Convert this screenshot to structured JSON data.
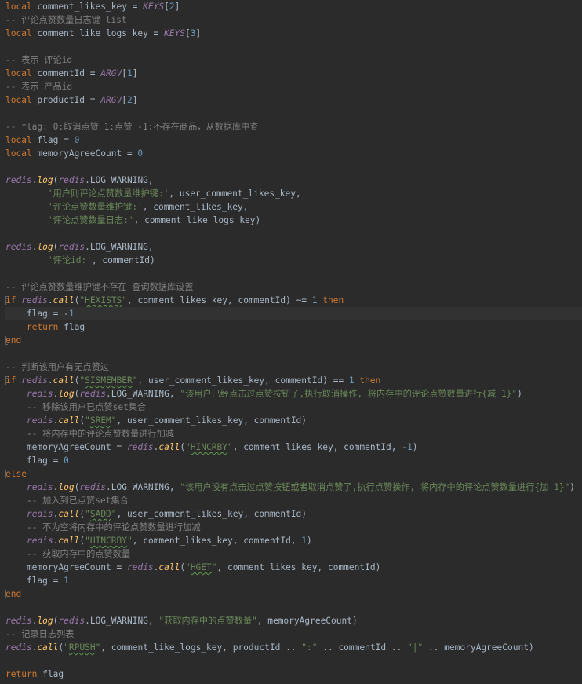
{
  "editor": {
    "language": "lua",
    "caret_line_index": 23,
    "colors": {
      "background": "#2b2b2b",
      "caret_line": "#323232",
      "keyword": "#cc7832",
      "identifier": "#a9b7c6",
      "global": "#9876aa",
      "function": "#ffc66d",
      "string": "#6a8759",
      "number": "#6897bb",
      "comment": "#808080"
    },
    "lines": [
      [
        [
          "kw",
          "local"
        ],
        [
          "ident",
          " comment_likes_key = "
        ],
        [
          "global",
          "KEYS"
        ],
        [
          "ident",
          "["
        ],
        [
          "num",
          "2"
        ],
        [
          "ident",
          "]"
        ]
      ],
      [
        [
          "cmt",
          "-- 评论点赞数量日志键 list"
        ]
      ],
      [
        [
          "kw",
          "local"
        ],
        [
          "ident",
          " comment_like_logs_key = "
        ],
        [
          "global",
          "KEYS"
        ],
        [
          "ident",
          "["
        ],
        [
          "num",
          "3"
        ],
        [
          "ident",
          "]"
        ]
      ],
      [],
      [
        [
          "cmt",
          "-- 表示 评论id"
        ]
      ],
      [
        [
          "kw",
          "local"
        ],
        [
          "ident",
          " commentId = "
        ],
        [
          "global",
          "ARGV"
        ],
        [
          "ident",
          "["
        ],
        [
          "num",
          "1"
        ],
        [
          "ident",
          "]"
        ]
      ],
      [
        [
          "cmt",
          "-- 表示 产品id"
        ]
      ],
      [
        [
          "kw",
          "local"
        ],
        [
          "ident",
          " productId = "
        ],
        [
          "global",
          "ARGV"
        ],
        [
          "ident",
          "["
        ],
        [
          "num",
          "2"
        ],
        [
          "ident",
          "]"
        ]
      ],
      [],
      [
        [
          "cmt",
          "-- flag: 0:取消点赞 1:点赞 -1:不存在商品，从数据库中查"
        ]
      ],
      [
        [
          "kw",
          "local"
        ],
        [
          "ident",
          " flag = "
        ],
        [
          "num",
          "0"
        ]
      ],
      [
        [
          "kw",
          "local"
        ],
        [
          "ident",
          " memoryAgreeCount = "
        ],
        [
          "num",
          "0"
        ]
      ],
      [],
      [
        [
          "global",
          "redis"
        ],
        [
          "ident",
          "."
        ],
        [
          "fn",
          "log"
        ],
        [
          "ident",
          "("
        ],
        [
          "global",
          "redis"
        ],
        [
          "ident",
          ".LOG_WARNING,"
        ]
      ],
      [
        [
          "ident",
          "        "
        ],
        [
          "str",
          "'用户则评论点赞数量维护键:'"
        ],
        [
          "ident",
          ", user_comment_likes_key,"
        ]
      ],
      [
        [
          "ident",
          "        "
        ],
        [
          "str",
          "'评论点赞数量维护键:'"
        ],
        [
          "ident",
          ", comment_likes_key,"
        ]
      ],
      [
        [
          "ident",
          "        "
        ],
        [
          "str",
          "'评论点赞数量日志:'"
        ],
        [
          "ident",
          ", comment_like_logs_key)"
        ]
      ],
      [],
      [
        [
          "global",
          "redis"
        ],
        [
          "ident",
          "."
        ],
        [
          "fn",
          "log"
        ],
        [
          "ident",
          "("
        ],
        [
          "global",
          "redis"
        ],
        [
          "ident",
          ".LOG_WARNING,"
        ]
      ],
      [
        [
          "ident",
          "        "
        ],
        [
          "str",
          "'评论id:'"
        ],
        [
          "ident",
          ", commentId)"
        ]
      ],
      [],
      [
        [
          "cmt",
          "-- 评论点赞数量维护键不存在 查询数据库设置"
        ]
      ],
      [
        [
          "kw",
          "if"
        ],
        [
          "ident",
          " "
        ],
        [
          "global",
          "redis"
        ],
        [
          "ident",
          "."
        ],
        [
          "fn",
          "call"
        ],
        [
          "ident",
          "("
        ],
        [
          "str",
          "\""
        ],
        [
          "str typo",
          "HEXISTS"
        ],
        [
          "str",
          "\""
        ],
        [
          "ident",
          ", comment_likes_key, commentId) ~= "
        ],
        [
          "num",
          "1"
        ],
        [
          "ident",
          " "
        ],
        [
          "kw",
          "then"
        ]
      ],
      [
        [
          "ident",
          "    flag = -"
        ],
        [
          "num",
          "1"
        ],
        [
          "caret",
          ""
        ]
      ],
      [
        [
          "ident",
          "    "
        ],
        [
          "kw",
          "return"
        ],
        [
          "ident",
          " flag"
        ]
      ],
      [
        [
          "kw",
          "end"
        ]
      ],
      [],
      [
        [
          "cmt",
          "-- 判断该用户有无点赞过"
        ]
      ],
      [
        [
          "kw",
          "if"
        ],
        [
          "ident",
          " "
        ],
        [
          "global",
          "redis"
        ],
        [
          "ident",
          "."
        ],
        [
          "fn",
          "call"
        ],
        [
          "ident",
          "("
        ],
        [
          "str",
          "\""
        ],
        [
          "str typo",
          "SISMEMBER"
        ],
        [
          "str",
          "\""
        ],
        [
          "ident",
          ", user_comment_likes_key, commentId) == "
        ],
        [
          "num",
          "1"
        ],
        [
          "ident",
          " "
        ],
        [
          "kw",
          "then"
        ]
      ],
      [
        [
          "ident",
          "    "
        ],
        [
          "global",
          "redis"
        ],
        [
          "ident",
          "."
        ],
        [
          "fn",
          "log"
        ],
        [
          "ident",
          "("
        ],
        [
          "global",
          "redis"
        ],
        [
          "ident",
          ".LOG_WARNING, "
        ],
        [
          "str",
          "\"该用户已经点击过点赞按钮了,执行取消操作, 将内存中的评论点赞数量进行{减 1}\""
        ],
        [
          "ident",
          ")"
        ]
      ],
      [
        [
          "cmt",
          "    -- 移除该用户已点赞set集合"
        ]
      ],
      [
        [
          "ident",
          "    "
        ],
        [
          "global",
          "redis"
        ],
        [
          "ident",
          "."
        ],
        [
          "fn",
          "call"
        ],
        [
          "ident",
          "("
        ],
        [
          "str",
          "\""
        ],
        [
          "str typo",
          "SREM"
        ],
        [
          "str",
          "\""
        ],
        [
          "ident",
          ", user_comment_likes_key, commentId)"
        ]
      ],
      [
        [
          "cmt",
          "    -- 将内存中的评论点赞数量进行加减"
        ]
      ],
      [
        [
          "ident",
          "    memoryAgreeCount = "
        ],
        [
          "global",
          "redis"
        ],
        [
          "ident",
          "."
        ],
        [
          "fn",
          "call"
        ],
        [
          "ident",
          "("
        ],
        [
          "str",
          "\""
        ],
        [
          "str typo",
          "HINCRBY"
        ],
        [
          "str",
          "\""
        ],
        [
          "ident",
          ", comment_likes_key, commentId, -"
        ],
        [
          "num",
          "1"
        ],
        [
          "ident",
          ")"
        ]
      ],
      [
        [
          "ident",
          "    flag = "
        ],
        [
          "num",
          "0"
        ]
      ],
      [
        [
          "kw",
          "else"
        ]
      ],
      [
        [
          "ident",
          "    "
        ],
        [
          "global",
          "redis"
        ],
        [
          "ident",
          "."
        ],
        [
          "fn",
          "log"
        ],
        [
          "ident",
          "("
        ],
        [
          "global",
          "redis"
        ],
        [
          "ident",
          ".LOG_WARNING, "
        ],
        [
          "str",
          "\"该用户没有点击过点赞按钮或者取消点赞了,执行点赞操作, 将内存中的评论点赞数量进行{加 1}\""
        ],
        [
          "ident",
          ")"
        ]
      ],
      [
        [
          "cmt",
          "    -- 加入到已点赞set集合"
        ]
      ],
      [
        [
          "ident",
          "    "
        ],
        [
          "global",
          "redis"
        ],
        [
          "ident",
          "."
        ],
        [
          "fn",
          "call"
        ],
        [
          "ident",
          "("
        ],
        [
          "str",
          "\""
        ],
        [
          "str typo",
          "SADD"
        ],
        [
          "str",
          "\""
        ],
        [
          "ident",
          ", user_comment_likes_key, commentId)"
        ]
      ],
      [
        [
          "cmt",
          "    -- 不为空将内存中的评论点赞数量进行加减"
        ]
      ],
      [
        [
          "ident",
          "    "
        ],
        [
          "global",
          "redis"
        ],
        [
          "ident",
          "."
        ],
        [
          "fn",
          "call"
        ],
        [
          "ident",
          "("
        ],
        [
          "str",
          "\""
        ],
        [
          "str typo",
          "HINCRBY"
        ],
        [
          "str",
          "\""
        ],
        [
          "ident",
          ", comment_likes_key, commentId, "
        ],
        [
          "num",
          "1"
        ],
        [
          "ident",
          ")"
        ]
      ],
      [
        [
          "cmt",
          "    -- 获取内存中的点赞数量"
        ]
      ],
      [
        [
          "ident",
          "    memoryAgreeCount = "
        ],
        [
          "global",
          "redis"
        ],
        [
          "ident",
          "."
        ],
        [
          "fn",
          "call"
        ],
        [
          "ident",
          "("
        ],
        [
          "str",
          "\""
        ],
        [
          "str typo",
          "HGET"
        ],
        [
          "str",
          "\""
        ],
        [
          "ident",
          ", comment_likes_key, commentId)"
        ]
      ],
      [
        [
          "ident",
          "    flag = "
        ],
        [
          "num",
          "1"
        ]
      ],
      [
        [
          "kw",
          "end"
        ]
      ],
      [],
      [
        [
          "global",
          "redis"
        ],
        [
          "ident",
          "."
        ],
        [
          "fn",
          "log"
        ],
        [
          "ident",
          "("
        ],
        [
          "global",
          "redis"
        ],
        [
          "ident",
          ".LOG_WARNING, "
        ],
        [
          "str",
          "\"获取内存中的点赞数量\""
        ],
        [
          "ident",
          ", memoryAgreeCount)"
        ]
      ],
      [
        [
          "cmt",
          "-- 记录日志列表"
        ]
      ],
      [
        [
          "global",
          "redis"
        ],
        [
          "ident",
          "."
        ],
        [
          "fn",
          "call"
        ],
        [
          "ident",
          "("
        ],
        [
          "str",
          "\""
        ],
        [
          "str typo",
          "RPUSH"
        ],
        [
          "str",
          "\""
        ],
        [
          "ident",
          ", comment_like_logs_key, productId .. "
        ],
        [
          "str",
          "\":\""
        ],
        [
          "ident",
          " .. commentId .. "
        ],
        [
          "str",
          "\"|\""
        ],
        [
          "ident",
          " .. memoryAgreeCount)"
        ]
      ],
      [],
      [
        [
          "kw",
          "return"
        ],
        [
          "ident",
          " flag"
        ]
      ]
    ],
    "fold_markers": [
      {
        "line": 22,
        "kind": "start"
      },
      {
        "line": 25,
        "kind": "end"
      },
      {
        "line": 28,
        "kind": "start"
      },
      {
        "line": 35,
        "kind": "start"
      },
      {
        "line": 44,
        "kind": "end"
      }
    ]
  }
}
